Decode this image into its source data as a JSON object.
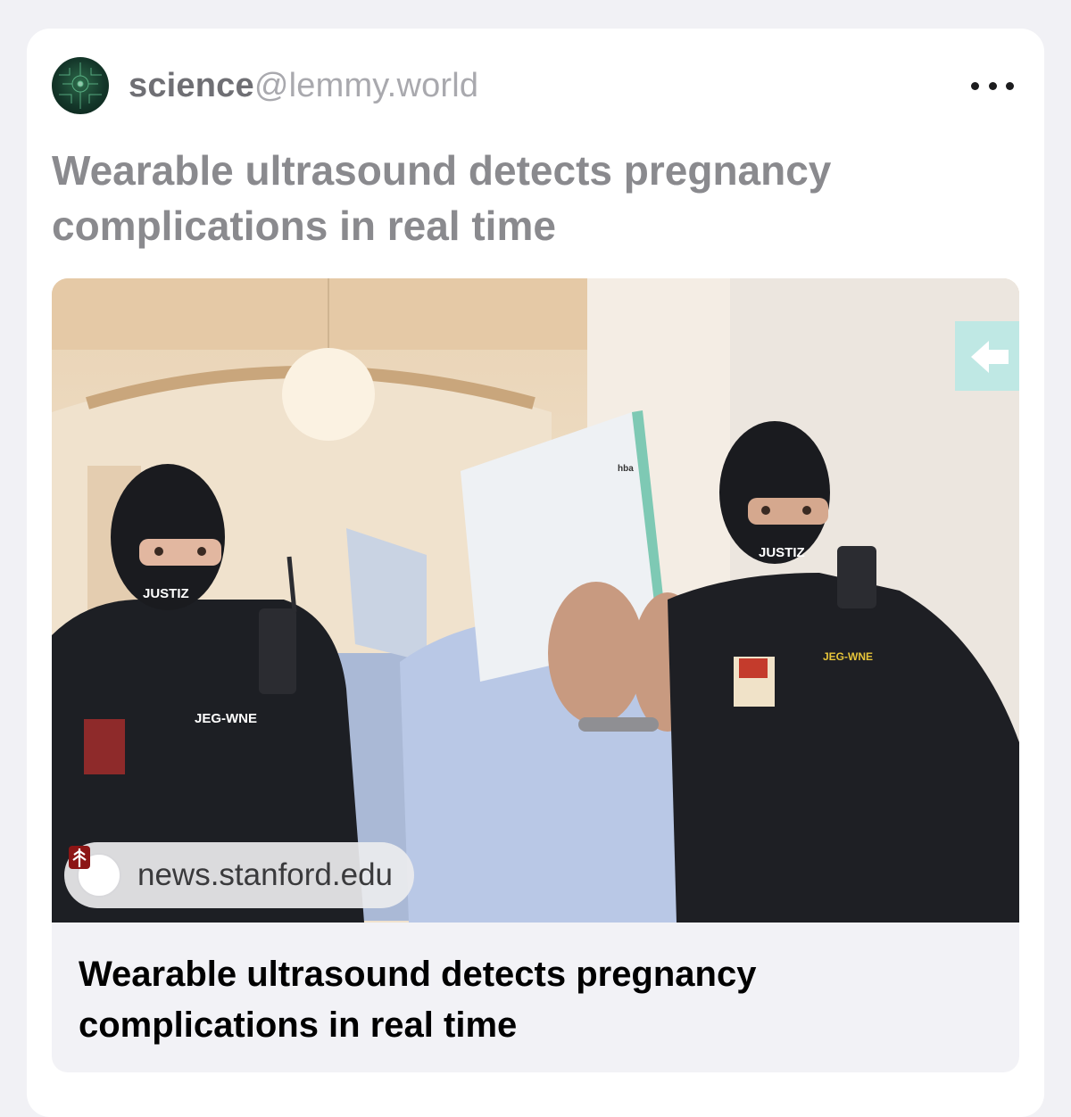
{
  "post": {
    "community_name": "science",
    "community_instance": "@lemmy.world",
    "title": "Wearable ultrasound detects pregnancy complications in real time"
  },
  "link_preview": {
    "domain": "news.stanford.edu",
    "title": "Wearable ultrasound detects pregnancy complications in real time",
    "image_text": {
      "left_mask": "JUSTIZ",
      "right_mask": "JUSTIZ",
      "left_patch": "JEG-WNE",
      "right_patch": "JEG-WNE",
      "binder_label": "hba"
    }
  },
  "icons": {
    "avatar": "community-avatar",
    "more": "more-options-icon",
    "domain": "stanford-logo-icon"
  }
}
